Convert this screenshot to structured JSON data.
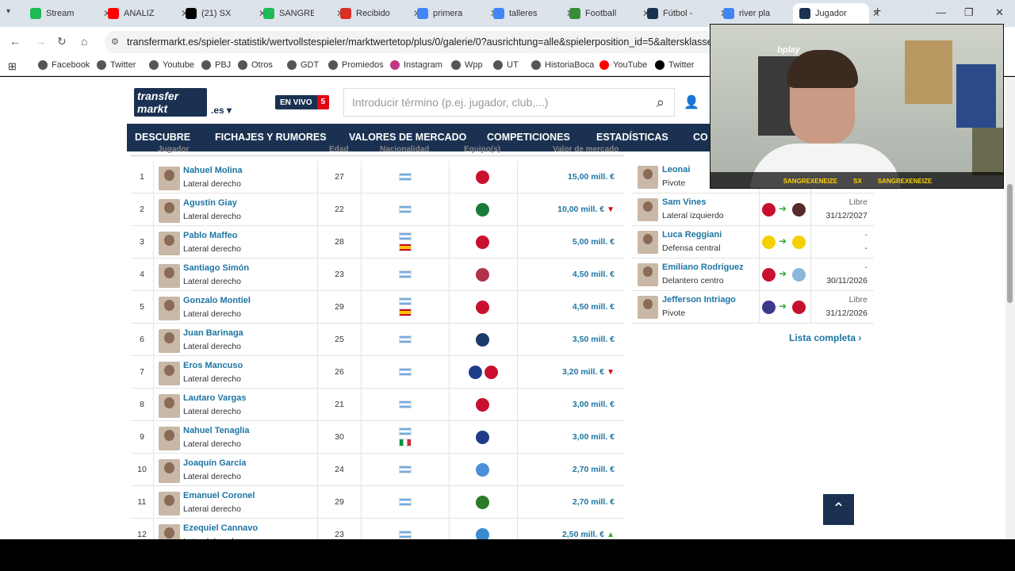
{
  "browser": {
    "tabs": [
      {
        "title": "Stream",
        "color": "#1db954"
      },
      {
        "title": "ANALIZ",
        "color": "#ff0000"
      },
      {
        "title": "(21) SX",
        "color": "#000000"
      },
      {
        "title": "SANGRE",
        "color": "#1db954"
      },
      {
        "title": "Recibido",
        "color": "#d93025"
      },
      {
        "title": "primera",
        "color": "#4285f4"
      },
      {
        "title": "talleres",
        "color": "#4285f4"
      },
      {
        "title": "Football",
        "color": "#3a8b3a"
      },
      {
        "title": "Fútbol -",
        "color": "#1a3151"
      },
      {
        "title": "river pla",
        "color": "#4285f4"
      },
      {
        "title": "Jugador",
        "color": "#1a3151"
      }
    ],
    "url": "transfermarkt.es/spieler-statistik/wertvollstespieler/marktwertetop/plus/0/galerie/0?ausrichtung=alle&spielerposition_id=5&altersklasse=alle&",
    "bookmarks": [
      {
        "label": "Facebook",
        "color": "#555"
      },
      {
        "label": "Twitter",
        "color": "#555"
      },
      {
        "label": "Youtube",
        "color": "#555"
      },
      {
        "label": "PBJ",
        "color": "#555"
      },
      {
        "label": "Otros",
        "color": "#555"
      },
      {
        "label": "GDT",
        "color": "#555"
      },
      {
        "label": "Promiedos",
        "color": "#555"
      },
      {
        "label": "Instagram",
        "color": "#c13584"
      },
      {
        "label": "Wpp",
        "color": "#555"
      },
      {
        "label": "UT",
        "color": "#555"
      },
      {
        "label": "HistoriaBoca",
        "color": "#555"
      },
      {
        "label": "YouTube",
        "color": "#ff0000"
      },
      {
        "label": "Twitter",
        "color": "#000"
      }
    ]
  },
  "site": {
    "logo_line1": "transfer",
    "logo_line2": "markt",
    "domain": ".es",
    "live_label": "EN VIVO",
    "live_count": "5",
    "search_placeholder": "Introducir término (p.ej. jugador, club,...)",
    "nav": [
      "DESCUBRE",
      "FICHAJES Y RUMORES",
      "VALORES DE MERCADO",
      "COMPETICIONES",
      "ESTADÍSTICAS",
      "CO"
    ]
  },
  "table": {
    "headers": {
      "player": "Jugador",
      "age": "Edad",
      "nat": "Nacionalidad",
      "club": "Equipo(s)",
      "value": "Valor de mercado"
    },
    "rows": [
      {
        "n": "1",
        "name": "Nahuel Molina",
        "pos": "Lateral derecho",
        "age": "27",
        "flags": [
          "ar"
        ],
        "clubs": [
          "#c8102e"
        ],
        "value": "15,00 mill. €",
        "trend": ""
      },
      {
        "n": "2",
        "name": "Agustín Giay",
        "pos": "Lateral derecho",
        "age": "22",
        "flags": [
          "ar"
        ],
        "clubs": [
          "#1a7a3a"
        ],
        "value": "10,00 mill. €",
        "trend": "down"
      },
      {
        "n": "3",
        "name": "Pablo Maffeo",
        "pos": "Lateral derecho",
        "age": "28",
        "flags": [
          "ar",
          "es"
        ],
        "clubs": [
          "#c8102e"
        ],
        "value": "5,00 mill. €",
        "trend": ""
      },
      {
        "n": "4",
        "name": "Santiago Simón",
        "pos": "Lateral derecho",
        "age": "23",
        "flags": [
          "ar"
        ],
        "clubs": [
          "#b0324b"
        ],
        "value": "4,50 mill. €",
        "trend": ""
      },
      {
        "n": "5",
        "name": "Gonzalo Montiel",
        "pos": "Lateral derecho",
        "age": "29",
        "flags": [
          "ar",
          "es"
        ],
        "clubs": [
          "#c8102e"
        ],
        "value": "4,50 mill. €",
        "trend": ""
      },
      {
        "n": "6",
        "name": "Juan Barinaga",
        "pos": "Lateral derecho",
        "age": "25",
        "flags": [
          "ar"
        ],
        "clubs": [
          "#1a3a6a"
        ],
        "value": "3,50 mill. €",
        "trend": ""
      },
      {
        "n": "7",
        "name": "Eros Mancuso",
        "pos": "Lateral derecho",
        "age": "26",
        "flags": [
          "ar"
        ],
        "clubs": [
          "#1e3c8a",
          "#c8102e"
        ],
        "value": "3,20 mill. €",
        "trend": "down"
      },
      {
        "n": "8",
        "name": "Lautaro Vargas",
        "pos": "Lateral derecho",
        "age": "21",
        "flags": [
          "ar"
        ],
        "clubs": [
          "#c8102e"
        ],
        "value": "3,00 mill. €",
        "trend": ""
      },
      {
        "n": "9",
        "name": "Nahuel Tenaglia",
        "pos": "Lateral derecho",
        "age": "30",
        "flags": [
          "ar",
          "it"
        ],
        "clubs": [
          "#1e3c8a"
        ],
        "value": "3,00 mill. €",
        "trend": ""
      },
      {
        "n": "10",
        "name": "Joaquín García",
        "pos": "Lateral derecho",
        "age": "24",
        "flags": [
          "ar"
        ],
        "clubs": [
          "#4a90d9"
        ],
        "value": "2,70 mill. €",
        "trend": ""
      },
      {
        "n": "11",
        "name": "Emanuel Coronel",
        "pos": "Lateral derecho",
        "age": "29",
        "flags": [
          "ar"
        ],
        "clubs": [
          "#2a7a2a"
        ],
        "value": "2,70 mill. €",
        "trend": ""
      },
      {
        "n": "12",
        "name": "Ezequiel Cannavo",
        "pos": "Lateral derecho",
        "age": "23",
        "flags": [
          "ar"
        ],
        "clubs": [
          "#3a8ad0"
        ],
        "value": "2,50 mill. €",
        "trend": "up"
      }
    ]
  },
  "sidebar": {
    "rows": [
      {
        "name": "Leonai",
        "pos": "Pivote",
        "from": "#1a3a6a",
        "to": "#c8102e",
        "t1": "",
        "t2": ""
      },
      {
        "name": "Sam Vines",
        "pos": "Lateral izquierdo",
        "from": "#c8102e",
        "to": "#5a2a2a",
        "t1": "Libre",
        "t2": "31/12/2027"
      },
      {
        "name": "Luca Reggiani",
        "pos": "Defensa central",
        "from": "#f4d000",
        "to": "#f4d000",
        "t1": "-",
        "t2": "-"
      },
      {
        "name": "Emiliano Rodríguez",
        "pos": "Delantero centro",
        "from": "#c8102e",
        "to": "#8ab8d8",
        "t1": "-",
        "t2": "30/11/2026"
      },
      {
        "name": "Jefferson Intriago",
        "pos": "Pivote",
        "from": "#3a3a8a",
        "to": "#c8102e",
        "t1": "Libre",
        "t2": "31/12/2026"
      }
    ],
    "more_label": "Lista completa"
  },
  "stream": {
    "brand": "bplay",
    "handles": [
      "SANGREXENEIZE",
      "SX",
      "SANGREXENEIZE"
    ]
  }
}
